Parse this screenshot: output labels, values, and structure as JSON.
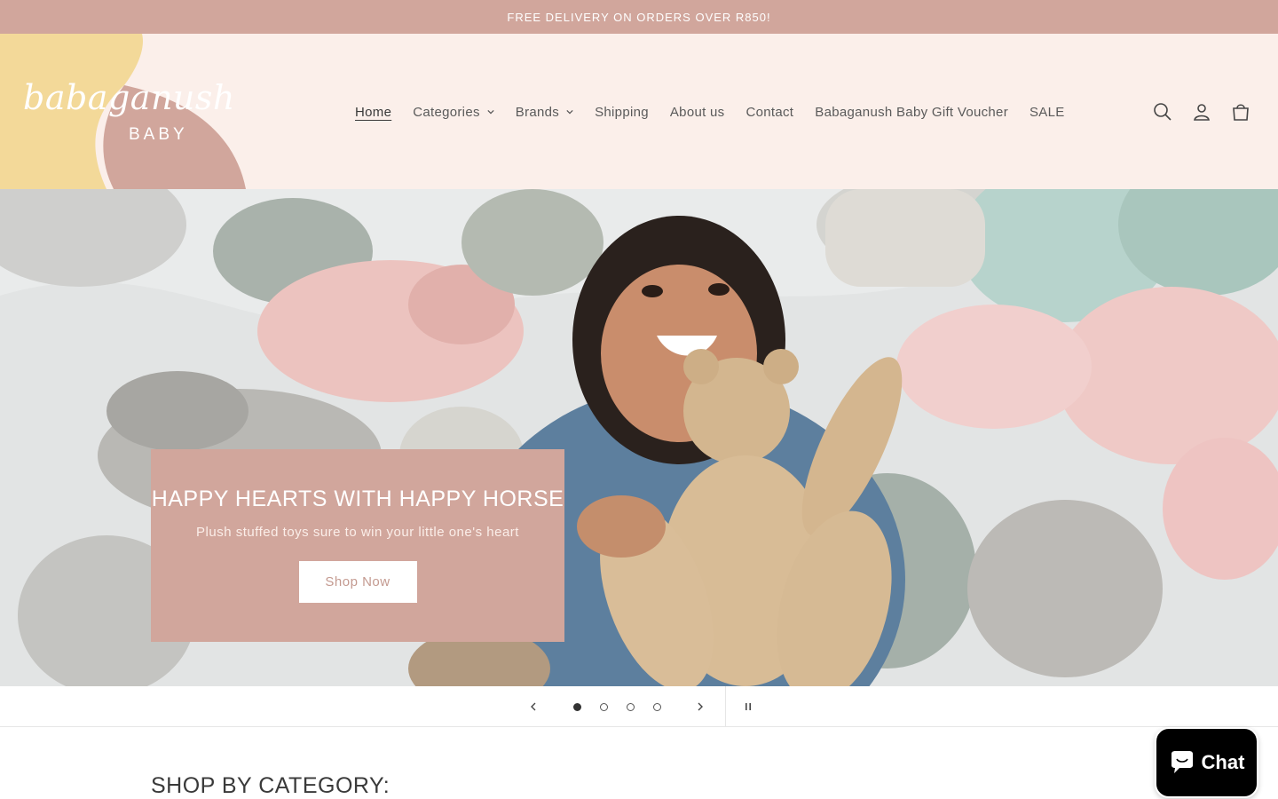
{
  "announcement": {
    "text": "FREE DELIVERY ON ORDERS OVER R850!"
  },
  "brand": {
    "script": "babaganush",
    "sub": "BABY"
  },
  "nav": {
    "items": [
      {
        "label": "Home",
        "active": true,
        "dropdown": false
      },
      {
        "label": "Categories",
        "active": false,
        "dropdown": true
      },
      {
        "label": "Brands",
        "active": false,
        "dropdown": true
      },
      {
        "label": "Shipping",
        "active": false,
        "dropdown": false
      },
      {
        "label": "About us",
        "active": false,
        "dropdown": false
      },
      {
        "label": "Contact",
        "active": false,
        "dropdown": false
      },
      {
        "label": "Babaganush Baby Gift Voucher",
        "active": false,
        "dropdown": false
      },
      {
        "label": "SALE",
        "active": false,
        "dropdown": false
      }
    ]
  },
  "header_icons": [
    "search-icon",
    "account-icon",
    "cart-icon"
  ],
  "hero": {
    "title": "HAPPY HEARTS WITH HAPPY HORSE",
    "subtitle": "Plush stuffed toys sure to win your little one's heart",
    "button": "Shop Now"
  },
  "slideshow": {
    "slide_count": 4,
    "current": 1
  },
  "section": {
    "title": "SHOP BY CATEGORY:"
  },
  "chat": {
    "label": "Chat"
  },
  "colors": {
    "accent": "#d1a69c",
    "header_bg": "#fbefea",
    "logo_yellow": "#f3d999"
  }
}
